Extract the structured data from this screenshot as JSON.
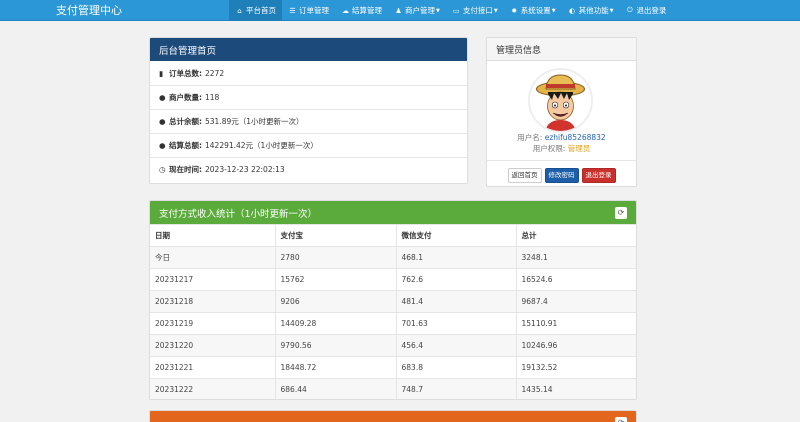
{
  "navbar": {
    "brand": "支付管理中心",
    "items": [
      {
        "label": "平台首页",
        "icon": "home-icon",
        "glyph": "⌂",
        "active": true,
        "dropdown": false
      },
      {
        "label": "订单管理",
        "icon": "list-icon",
        "glyph": "☰",
        "active": false,
        "dropdown": false
      },
      {
        "label": "结算管理",
        "icon": "cloud-icon",
        "glyph": "☁",
        "active": false,
        "dropdown": false
      },
      {
        "label": "商户管理",
        "icon": "user-icon",
        "glyph": "♟",
        "active": false,
        "dropdown": true
      },
      {
        "label": "支付接口",
        "icon": "credit-card-icon",
        "glyph": "▭",
        "active": false,
        "dropdown": true
      },
      {
        "label": "系统设置",
        "icon": "gear-icon",
        "glyph": "✹",
        "active": false,
        "dropdown": true
      },
      {
        "label": "其他功能",
        "icon": "globe-icon",
        "glyph": "◐",
        "active": false,
        "dropdown": true
      },
      {
        "label": "退出登录",
        "icon": "power-icon",
        "glyph": "⏻",
        "active": false,
        "dropdown": false
      }
    ]
  },
  "home": {
    "title": "后台管理首页",
    "stats": [
      {
        "icon": "bar-chart-icon",
        "glyph": "▮",
        "label": "订单总数:",
        "value": "2272"
      },
      {
        "icon": "tint-icon",
        "glyph": "●",
        "label": "商户数量:",
        "value": "118"
      },
      {
        "icon": "tint-icon",
        "glyph": "●",
        "label": "总计余额:",
        "value": "531.89元（1小时更新一次）"
      },
      {
        "icon": "tint-icon",
        "glyph": "●",
        "label": "结算总额:",
        "value": "142291.42元（1小时更新一次）"
      },
      {
        "icon": "clock-icon",
        "glyph": "◷",
        "label": "现在时间:",
        "value": "2023-12-23 22:02:13"
      }
    ]
  },
  "admin": {
    "title": "管理员信息",
    "username_label": "用户名: ",
    "username": "ezhifu85268832",
    "role_label": "用户权限: ",
    "role": "管理员",
    "buttons": {
      "home": "返回首页",
      "change_password": "修改密码",
      "logout": "退出登录"
    }
  },
  "income": {
    "title": "支付方式收入统计（1小时更新一次）",
    "headers": [
      "日期",
      "支付宝",
      "微信支付",
      "总计"
    ],
    "rows": [
      [
        "今日",
        "2780",
        "468.1",
        "3248.1"
      ],
      [
        "20231217",
        "15762",
        "762.6",
        "16524.6"
      ],
      [
        "20231218",
        "9206",
        "481.4",
        "9687.4"
      ],
      [
        "20231219",
        "14409.28",
        "701.63",
        "15110.91"
      ],
      [
        "20231220",
        "9790.56",
        "456.4",
        "10246.96"
      ],
      [
        "20231221",
        "18448.72",
        "683.8",
        "19132.52"
      ],
      [
        "20231222",
        "686.44",
        "748.7",
        "1435.14"
      ]
    ]
  },
  "colors": {
    "navbar": "#2b97d6",
    "home_heading": "#1c4a7a",
    "income_heading": "#5bab3c",
    "orange_heading": "#e2661b"
  }
}
